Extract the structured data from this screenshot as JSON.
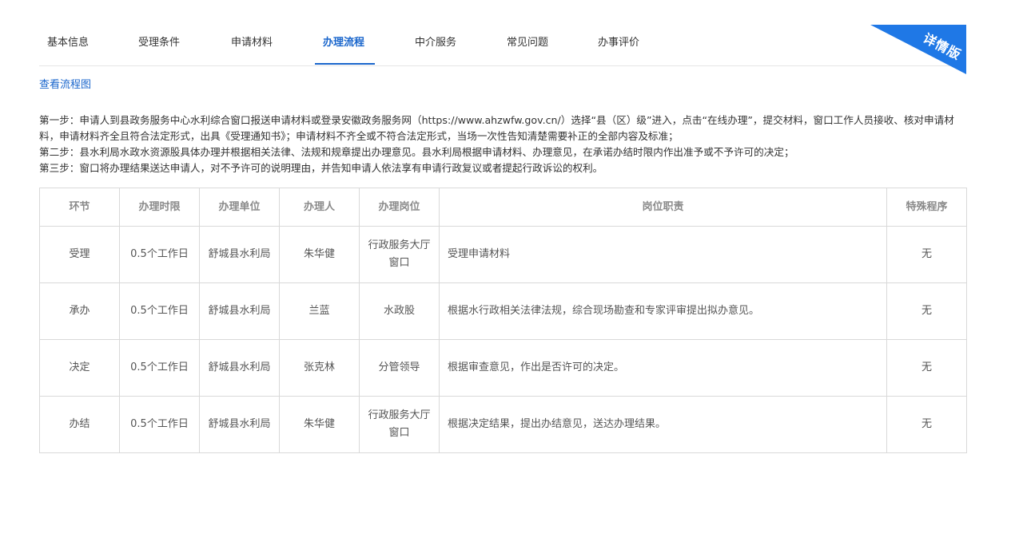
{
  "tabs": [
    {
      "label": "基本信息",
      "active": false
    },
    {
      "label": "受理条件",
      "active": false
    },
    {
      "label": "申请材料",
      "active": false
    },
    {
      "label": "办理流程",
      "active": true
    },
    {
      "label": "中介服务",
      "active": false
    },
    {
      "label": "常见问题",
      "active": false
    },
    {
      "label": "办事评价",
      "active": false
    }
  ],
  "ribbon": {
    "label": "详情版"
  },
  "flow_link": "查看流程图",
  "steps": [
    "第一步：申请人到县政务服务中心水利综合窗口报送申请材料或登录安徽政务服务网（https://www.ahzwfw.gov.cn/）选择“县（区）级”进入，点击“在线办理”，提交材料，窗口工作人员接收、核对申请材料，申请材料齐全且符合法定形式，出具《受理通知书》；申请材料不齐全或不符合法定形式，当场一次性告知清楚需要补正的全部内容及标准；",
    "第二步：县水利局水政水资源股具体办理并根据相关法律、法规和规章提出办理意见。县水利局根据申请材料、办理意见，在承诺办结时限内作出准予或不予许可的决定；",
    "第三步：窗口将办理结果送达申请人，对不予许可的说明理由，并告知申请人依法享有申请行政复议或者提起行政诉讼的权利。"
  ],
  "table": {
    "headers": [
      "环节",
      "办理时限",
      "办理单位",
      "办理人",
      "办理岗位",
      "岗位职责",
      "特殊程序"
    ],
    "rows": [
      [
        "受理",
        "0.5个工作日",
        "舒城县水利局",
        "朱华健",
        "行政服务大厅窗口",
        "受理申请材料",
        "无"
      ],
      [
        "承办",
        "0.5个工作日",
        "舒城县水利局",
        "兰蓝",
        "水政股",
        "根据水行政相关法律法规，综合现场勘查和专家评审提出拟办意见。",
        "无"
      ],
      [
        "决定",
        "0.5个工作日",
        "舒城县水利局",
        "张克林",
        "分管领导",
        "根据审查意见，作出是否许可的决定。",
        "无"
      ],
      [
        "办结",
        "0.5个工作日",
        "舒城县水利局",
        "朱华健",
        "行政服务大厅窗口",
        "根据决定结果，提出办结意见，送达办理结果。",
        "无"
      ]
    ]
  },
  "colors": {
    "accent": "#1a66cc",
    "ribbon": "#1a73e8",
    "border": "#d9d9d9"
  }
}
